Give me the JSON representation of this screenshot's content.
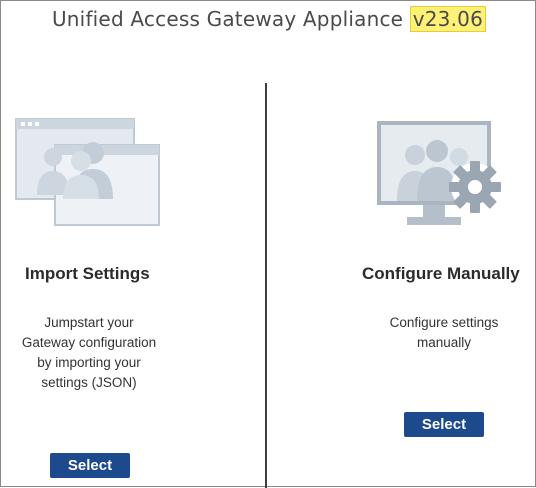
{
  "header": {
    "title": "Unified Access Gateway Appliance",
    "version": "v23.06"
  },
  "panels": [
    {
      "title": "Import Settings",
      "description": "Jumpstart your\nGateway configuration\nby importing your\nsettings (JSON)",
      "button_label": "Select",
      "icon": "import-settings-icon"
    },
    {
      "title": "Configure Manually",
      "description": "Configure settings\nmanually",
      "button_label": "Select",
      "icon": "configure-manually-icon"
    }
  ],
  "colors": {
    "button": "#1d4a8c",
    "version_highlight": "#fff176",
    "icon_fill": "#d4dde6",
    "icon_stroke": "#b9c4cf"
  }
}
